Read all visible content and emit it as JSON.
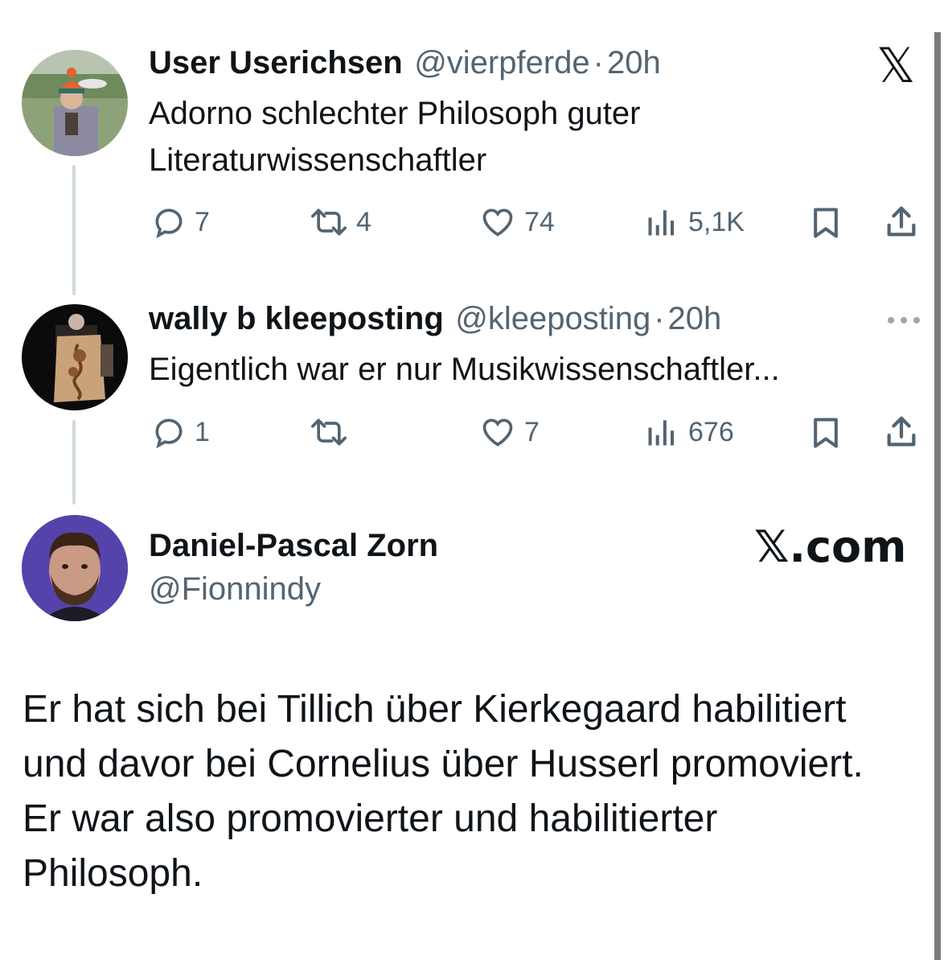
{
  "tweets": [
    {
      "name": "User Userichsen",
      "handle": "@vierpferde",
      "time": "20h",
      "text_lines": [
        "Adorno schlechter Philosoph guter",
        "Literaturwissenschaftler"
      ],
      "replies": "7",
      "retweets": "4",
      "likes": "74",
      "views": "5,1K"
    },
    {
      "name": "wally b kleeposting",
      "handle": "@kleeposting",
      "time": "20h",
      "text_lines": [
        "Eigentlich war er nur Musikwissenschaftler..."
      ],
      "replies": "1",
      "retweets": "",
      "likes": "7",
      "views": "676"
    }
  ],
  "reply_author": {
    "name": "Daniel-Pascal Zorn",
    "handle": "@Fionnindy"
  },
  "brand": "𝕏.com",
  "x_logo": "𝕏",
  "reply_text_lines": [
    "Er hat sich bei Tillich über Kierkegaard habilitiert",
    "und davor bei Cornelius über Husserl promoviert.",
    "Er war also promovierter und habilitierter",
    "Philosoph."
  ],
  "separator": "·",
  "icons": [
    "x-logo-icon",
    "more-icon",
    "reply-icon",
    "retweet-icon",
    "like-icon",
    "views-icon",
    "bookmark-icon",
    "share-icon"
  ],
  "colors": {
    "text": "#0f1419",
    "secondary": "#536471",
    "thread_line": "#cfd9de"
  }
}
